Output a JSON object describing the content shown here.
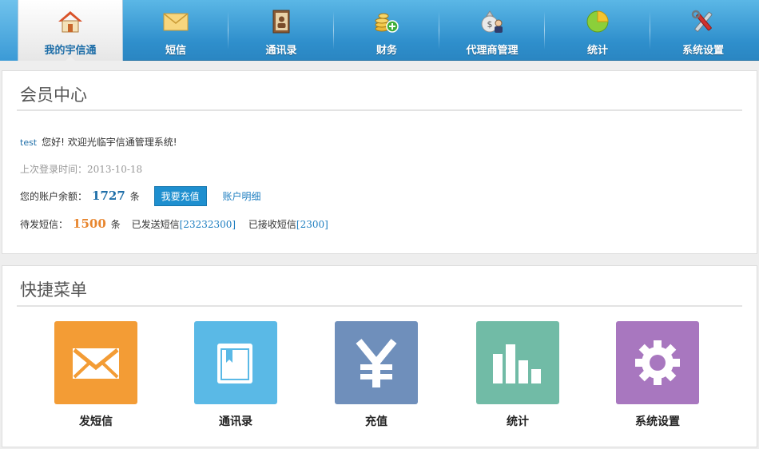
{
  "nav": {
    "items": [
      {
        "label": "我的宇信通",
        "icon": "home-icon"
      },
      {
        "label": "短信",
        "icon": "envelope-icon"
      },
      {
        "label": "通讯录",
        "icon": "address-book-icon"
      },
      {
        "label": "财务",
        "icon": "coins-icon"
      },
      {
        "label": "代理商管理",
        "icon": "money-bag-agent-icon"
      },
      {
        "label": "统计",
        "icon": "pie-chart-icon"
      },
      {
        "label": "系统设置",
        "icon": "tools-icon"
      }
    ],
    "active_index": 0
  },
  "member": {
    "title": "会员中心",
    "username": "test",
    "welcome": "您好! 欢迎光临宇信通管理系统!",
    "last_login": "上次登录时间：2013-10-18",
    "balance_label": "您的账户余额：",
    "balance_value": "1727",
    "unit": "条",
    "recharge_button": "我要充值",
    "account_detail_link": "账户明细",
    "pending_label": "待发短信：",
    "pending_value": "1500",
    "sent_label": "已发送短信",
    "sent_value": "[23232300]",
    "received_label": "已接收短信",
    "received_value": "[2300]"
  },
  "quick": {
    "title": "快捷菜单",
    "items": [
      {
        "label": "发短信",
        "icon": "envelope-icon",
        "color": "#f39c35"
      },
      {
        "label": "通讯录",
        "icon": "book-icon",
        "color": "#5ab9e6"
      },
      {
        "label": "充值",
        "icon": "yen-icon",
        "color": "#6f8fbb"
      },
      {
        "label": "统计",
        "icon": "bar-chart-icon",
        "color": "#71bba6"
      },
      {
        "label": "系统设置",
        "icon": "gear-icon",
        "color": "#a877bf"
      }
    ]
  }
}
